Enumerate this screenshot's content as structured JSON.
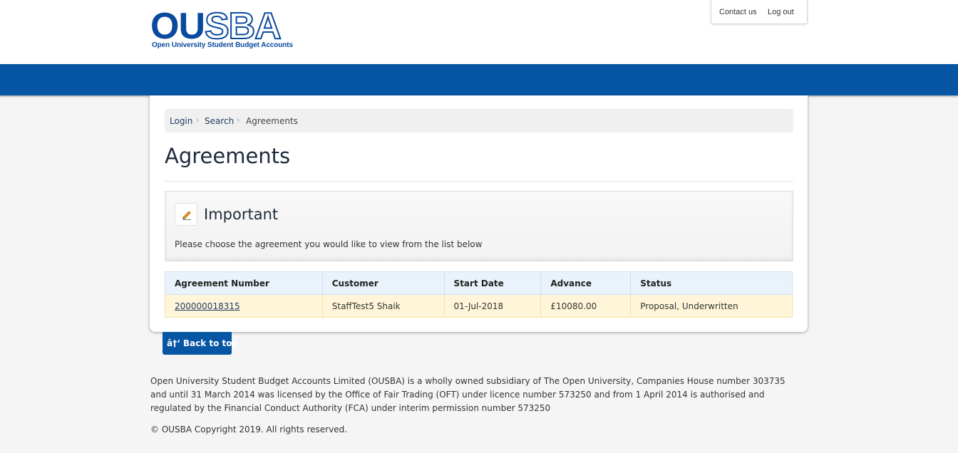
{
  "header": {
    "logo_main_ou": "OU",
    "logo_main_sba": "SBA",
    "logo_subtitle": "Open University Student Budget Accounts",
    "links": {
      "contact": "Contact us",
      "logout": "Log out"
    }
  },
  "breadcrumb": [
    "Login",
    "Search",
    "Agreements"
  ],
  "page_title": "Agreements",
  "notice": {
    "icon": "pencil-icon",
    "title": "Important",
    "text": "Please choose the agreement you would like to view from the list below"
  },
  "table": {
    "headers": [
      "Agreement Number",
      "Customer",
      "Start Date",
      "Advance",
      "Status"
    ],
    "rows": [
      [
        "200000018315",
        "StaffTest5 Shaik",
        "01-Jul-2018",
        "£10080.00",
        "Proposal, Underwritten"
      ]
    ]
  },
  "back_to_top": "â†‘ Back to top",
  "footer": {
    "legal": "Open University Student Budget Accounts Limited (OUSBA) is a wholly owned subsidiary of The Open University, Companies House number 303735 and until 31 March 2014 was licensed by the Office of Fair Trading (OFT) under licence number 573250 and from 1 April 2014 is authorised and regulated by the Financial Conduct Authority (FCA) under interim permission number 573250",
    "copyright": "© OUSBA Copyright 2019. All rights reserved."
  },
  "colors": {
    "brand_blue": "#0656a4",
    "logo_blue": "#0a4a9e",
    "table_header_bg": "#eaf3fb",
    "table_row_bg": "#fff6d9"
  }
}
